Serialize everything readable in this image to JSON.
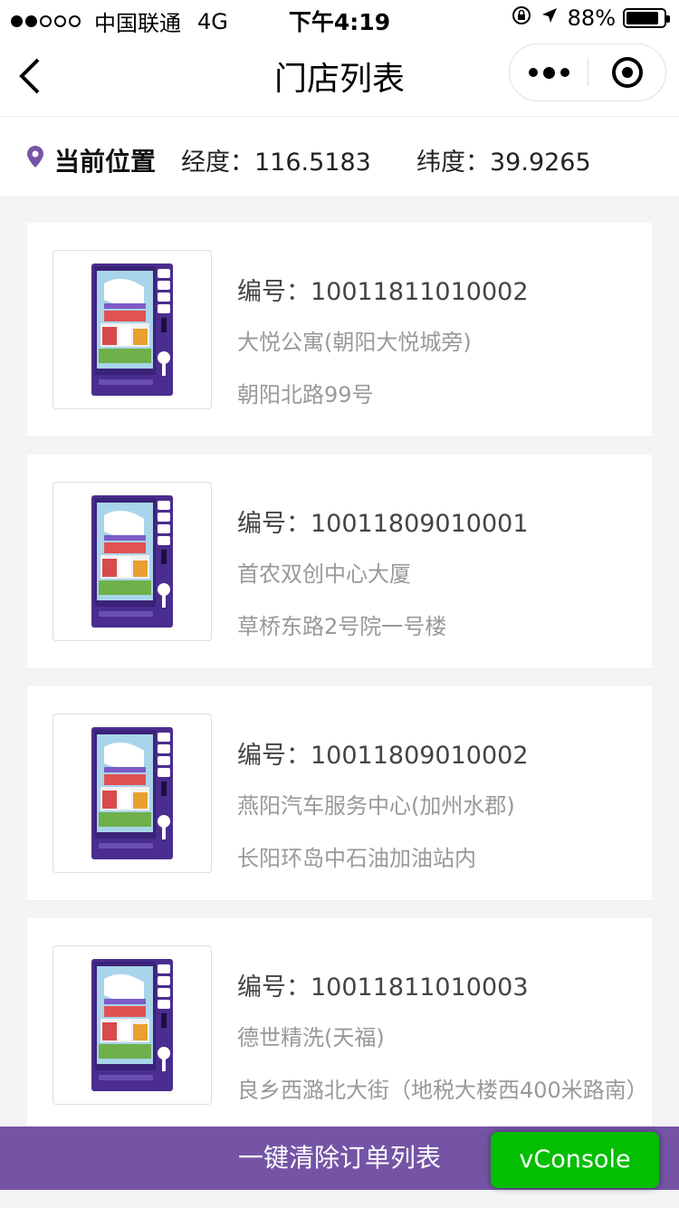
{
  "status_bar": {
    "carrier": "中国联通",
    "network": "4G",
    "time": "下午4:19",
    "battery": "88%",
    "battery_level": 0.88,
    "icons": [
      "rotation-lock-icon",
      "location-arrow-icon",
      "battery-icon"
    ]
  },
  "nav": {
    "title": "门店列表",
    "icons": [
      "back-arrow-icon",
      "more-dots-icon",
      "close-target-icon"
    ]
  },
  "location": {
    "label": "当前位置",
    "longitude": "经度：116.5183",
    "latitude": "纬度：39.9265",
    "icon": "location-pin-icon",
    "accent_color": "#7554a6"
  },
  "stores": [
    {
      "code": "编号：10011811010002",
      "name": "大悦公寓(朝阳大悦城旁)",
      "address": "朝阳北路99号"
    },
    {
      "code": "编号：10011809010001",
      "name": "首农双创中心大厦",
      "address": "草桥东路2号院一号楼"
    },
    {
      "code": "编号：10011809010002",
      "name": "燕阳汽车服务中心(加州水郡)",
      "address": "长阳环岛中石油加油站内"
    },
    {
      "code": "编号：10011811010003",
      "name": "德世精洗(天福)",
      "address": "良乡西潞北大街（地税大楼西400米路南）"
    }
  ],
  "bottom": {
    "clear_label": "一键清除订单列表",
    "bar_color": "#7554a6"
  },
  "vconsole": {
    "label": "vConsole",
    "color": "#04be02"
  }
}
